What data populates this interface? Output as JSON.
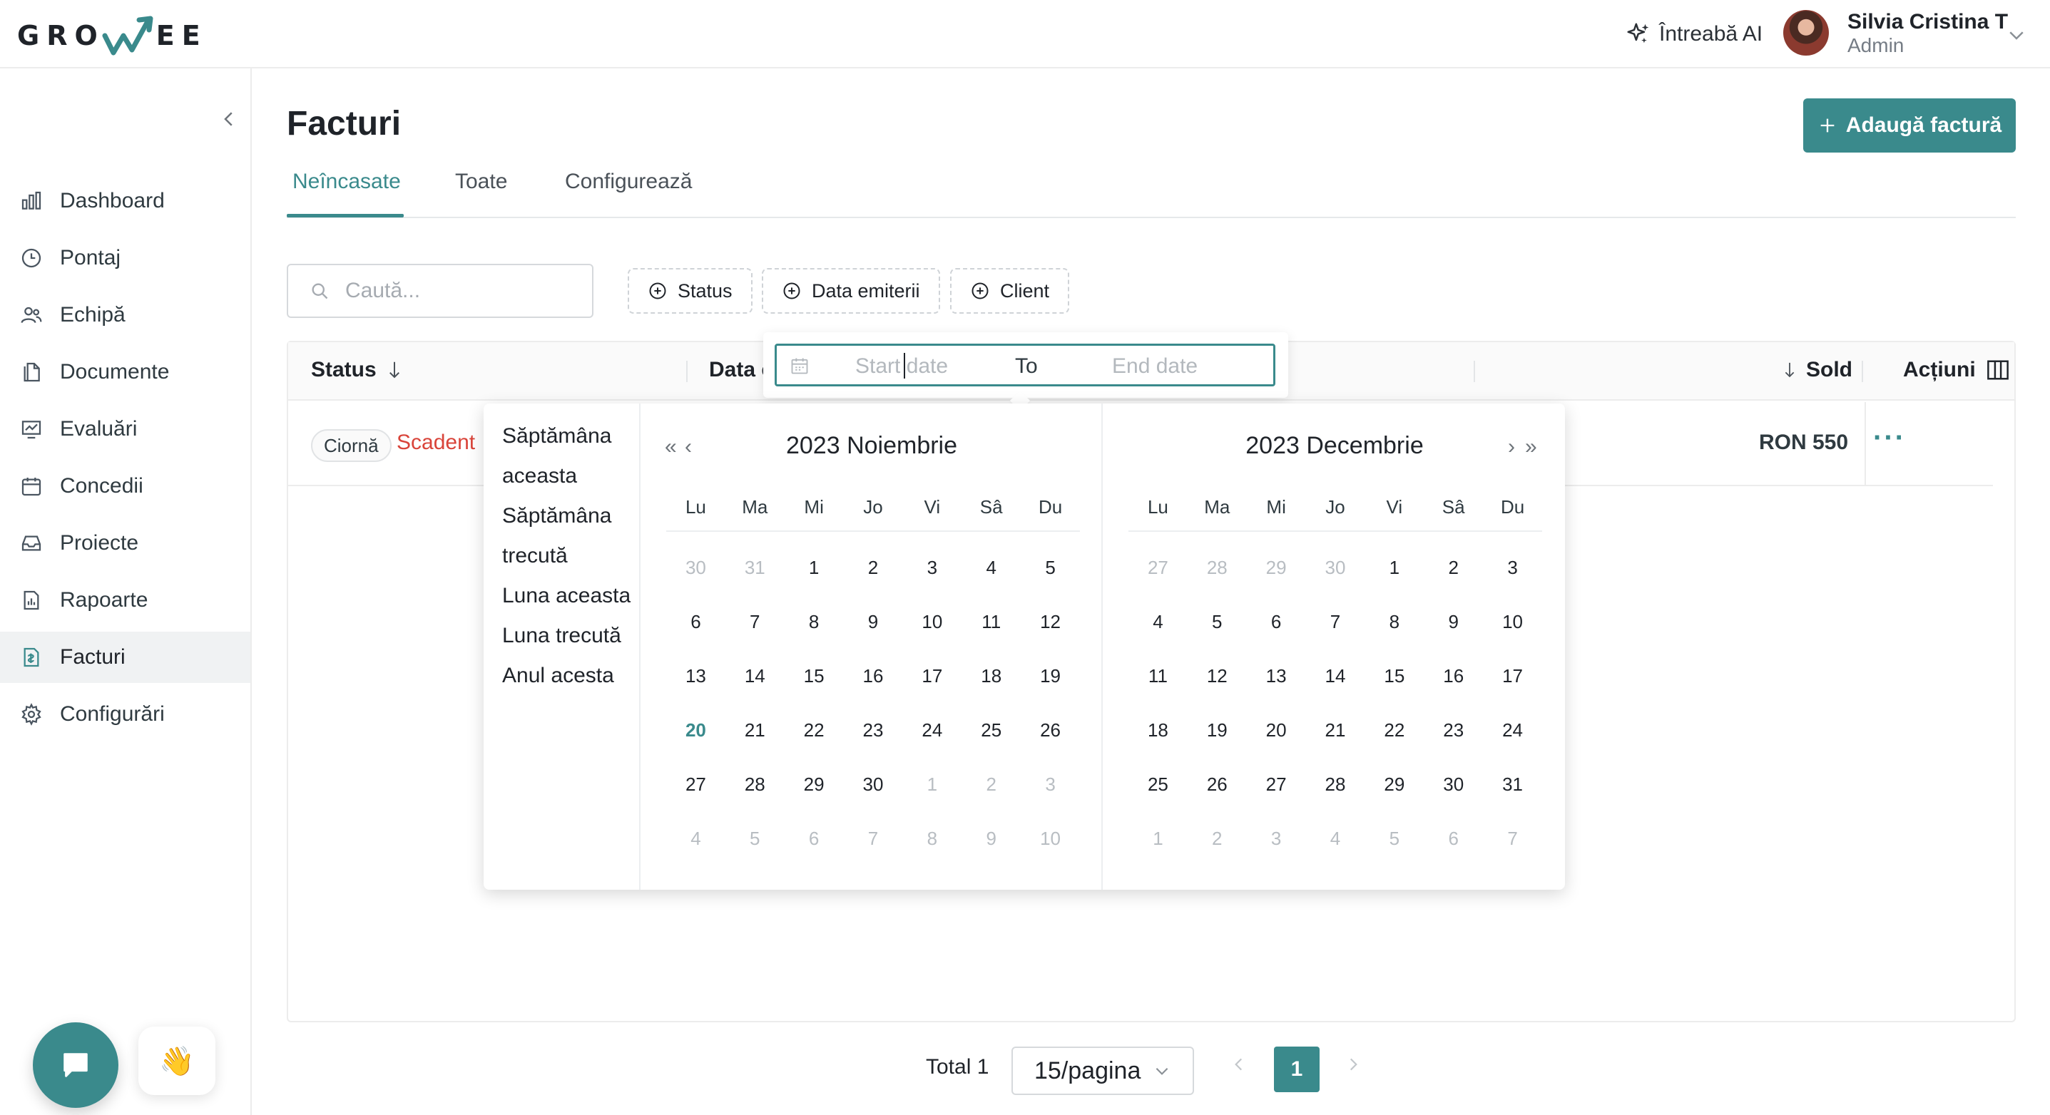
{
  "app": {
    "logo_left": "GRO",
    "logo_right": "EE"
  },
  "header": {
    "ask_ai": "Întreabă AI",
    "user_name": "Silvia Cristina T",
    "user_role": "Admin"
  },
  "sidebar": {
    "items": [
      {
        "label": "Dashboard",
        "icon": "bar-chart-icon"
      },
      {
        "label": "Pontaj",
        "icon": "clock-icon"
      },
      {
        "label": "Echipă",
        "icon": "users-icon"
      },
      {
        "label": "Documente",
        "icon": "documents-icon"
      },
      {
        "label": "Evaluări",
        "icon": "evaluation-icon"
      },
      {
        "label": "Concedii",
        "icon": "calendar-icon"
      },
      {
        "label": "Proiecte",
        "icon": "inbox-icon"
      },
      {
        "label": "Rapoarte",
        "icon": "report-icon"
      },
      {
        "label": "Facturi",
        "icon": "invoice-icon",
        "active": true
      },
      {
        "label": "Configurări",
        "icon": "gear-icon"
      }
    ]
  },
  "page": {
    "title": "Facturi",
    "add_button": "Adaugă factură",
    "tabs": [
      {
        "label": "Neîncasate",
        "active": true
      },
      {
        "label": "Toate"
      },
      {
        "label": "Configurează"
      }
    ],
    "search_placeholder": "Caută...",
    "filters": [
      "Status",
      "Data emiterii",
      "Client"
    ]
  },
  "table": {
    "columns": {
      "status": "Status",
      "date": "Data e",
      "sold": "Sold",
      "actions": "Acțiuni"
    },
    "rows": [
      {
        "status_badge": "Ciornă",
        "status_text": "Scadent",
        "sold": "RON 550",
        "actions": "···"
      }
    ]
  },
  "pagination": {
    "total": "Total 1",
    "page_size": "15/pagina",
    "current_page": "1"
  },
  "date_picker": {
    "start_placeholder": "Start date",
    "to_label": "To",
    "end_placeholder": "End date",
    "presets": [
      "Săptămâna aceasta",
      "Săptămâna trecută",
      "Luna aceasta",
      "Luna trecută",
      "Anul acesta"
    ],
    "weekdays": [
      "Lu",
      "Ma",
      "Mi",
      "Jo",
      "Vi",
      "Sâ",
      "Du"
    ],
    "months": [
      {
        "title": "2023 Noiembrie",
        "days": [
          "30",
          "31",
          "1",
          "2",
          "3",
          "4",
          "5",
          "6",
          "7",
          "8",
          "9",
          "10",
          "11",
          "12",
          "13",
          "14",
          "15",
          "16",
          "17",
          "18",
          "19",
          "20",
          "21",
          "22",
          "23",
          "24",
          "25",
          "26",
          "27",
          "28",
          "29",
          "30",
          "1",
          "2",
          "3",
          "4",
          "5",
          "6",
          "7",
          "8",
          "9",
          "10"
        ],
        "first_in_month": 2,
        "last_in_month": 31,
        "today_index": 21
      },
      {
        "title": "2023 Decembrie",
        "days": [
          "27",
          "28",
          "29",
          "30",
          "1",
          "2",
          "3",
          "4",
          "5",
          "6",
          "7",
          "8",
          "9",
          "10",
          "11",
          "12",
          "13",
          "14",
          "15",
          "16",
          "17",
          "18",
          "19",
          "20",
          "21",
          "22",
          "23",
          "24",
          "25",
          "26",
          "27",
          "28",
          "29",
          "30",
          "31",
          "1",
          "2",
          "3",
          "4",
          "5",
          "6",
          "7"
        ],
        "first_in_month": 4,
        "last_in_month": 34,
        "today_index": -1
      }
    ]
  },
  "colors": {
    "accent": "#3a8a8c",
    "danger": "#d9443a"
  }
}
